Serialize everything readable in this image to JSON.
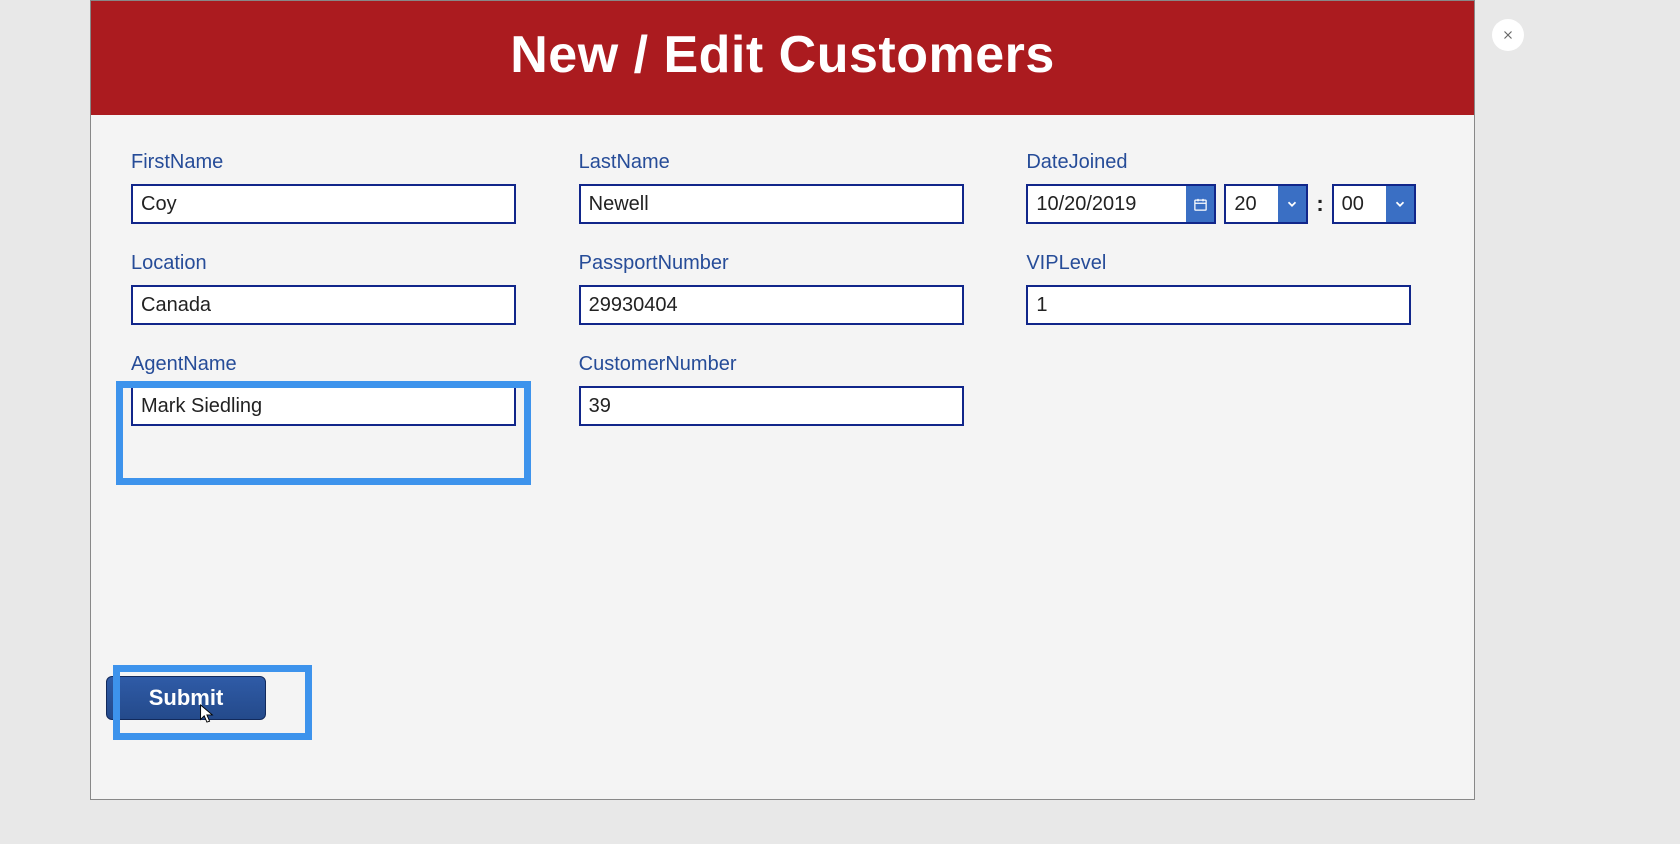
{
  "header": {
    "title": "New / Edit Customers"
  },
  "fields": {
    "firstName": {
      "label": "FirstName",
      "value": "Coy"
    },
    "lastName": {
      "label": "LastName",
      "value": "Newell"
    },
    "dateJoined": {
      "label": "DateJoined",
      "date": "10/20/2019",
      "hour": "20",
      "minute": "00"
    },
    "location": {
      "label": "Location",
      "value": "Canada"
    },
    "passport": {
      "label": "PassportNumber",
      "value": "29930404"
    },
    "vip": {
      "label": "VIPLevel",
      "value": "1"
    },
    "agent": {
      "label": "AgentName",
      "value": "Mark Siedling"
    },
    "customerNum": {
      "label": "CustomerNumber",
      "value": "39"
    }
  },
  "buttons": {
    "submit": "Submit"
  },
  "timeSeparator": ":"
}
